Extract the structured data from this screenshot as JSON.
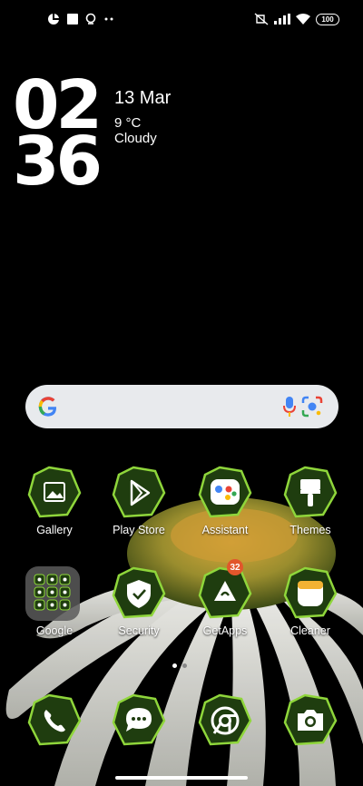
{
  "status_bar": {
    "battery": "100",
    "left_icons": [
      "notification-icon",
      "square-icon",
      "location-icon",
      "more-dots-icon"
    ],
    "right_icons": [
      "mute-vibrate-icon",
      "signal-icon",
      "wifi-icon",
      "battery-icon"
    ]
  },
  "clock": {
    "hour": "02",
    "minute": "36",
    "date": "13 Mar",
    "temperature": "9 °C",
    "weather": "Cloudy"
  },
  "search": {
    "icons": [
      "google-g-icon",
      "microphone-icon",
      "google-lens-icon"
    ]
  },
  "apps_row1": [
    {
      "label": "Gallery",
      "icon": "gallery-icon"
    },
    {
      "label": "Play Store",
      "icon": "play-store-icon"
    },
    {
      "label": "Assistant",
      "icon": "assistant-icon"
    },
    {
      "label": "Themes",
      "icon": "paint-brush-icon"
    }
  ],
  "apps_row2": [
    {
      "label": "Google",
      "icon": "folder-icon"
    },
    {
      "label": "Security",
      "icon": "shield-icon"
    },
    {
      "label": "GetApps",
      "icon": "getapps-icon",
      "badge": "32"
    },
    {
      "label": "Cleaner",
      "icon": "cleaner-icon"
    }
  ],
  "dock": [
    {
      "icon": "phone-icon"
    },
    {
      "icon": "messages-icon"
    },
    {
      "icon": "chrome-icon"
    },
    {
      "icon": "camera-icon"
    }
  ],
  "colors": {
    "icon_bg": "#1f3d0f",
    "icon_border": "#8fd63b",
    "badge": "#e2562b"
  }
}
